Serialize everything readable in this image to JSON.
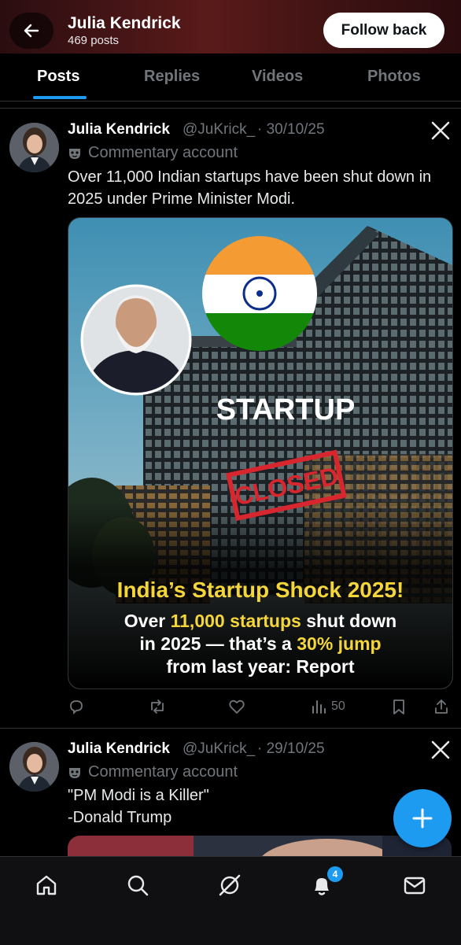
{
  "header": {
    "title": "Julia Kendrick",
    "post_count": "469 posts",
    "follow_label": "Follow back"
  },
  "tabs": [
    {
      "label": "Posts",
      "active": true
    },
    {
      "label": "Replies",
      "active": false
    },
    {
      "label": "Videos",
      "active": false
    },
    {
      "label": "Photos",
      "active": false
    }
  ],
  "posts": [
    {
      "author": "Julia Kendrick",
      "handle": "@JuKrick_",
      "date": "· 30/10/25",
      "commentary": "Commentary account",
      "text": "Over 11,000 Indian startups have been shut down in 2025 under Prime Minister Modi.",
      "media": {
        "headline_top": "STARTUP",
        "stamp": "CLOSED",
        "title": "India’s Startup Shock 2025!",
        "line1_a": "Over ",
        "line1_b": "11,000 startups",
        "line1_c": " shut down",
        "line2_a": "in 2025 — that’s a ",
        "line2_b": "30% jump",
        "line3": "from last year: Report"
      },
      "views": "50"
    },
    {
      "author": "Julia Kendrick",
      "handle": "@JuKrick_",
      "date": "· 29/10/25",
      "commentary": "Commentary account",
      "text_line1": "\"PM Modi is a Killer\"",
      "text_line2": "-Donald Trump"
    }
  ],
  "nav": {
    "notifications_badge": "4"
  },
  "colors": {
    "accent": "#1d9bf0",
    "background": "#000000",
    "muted": "#71767b",
    "highlight": "#f5d63a"
  }
}
